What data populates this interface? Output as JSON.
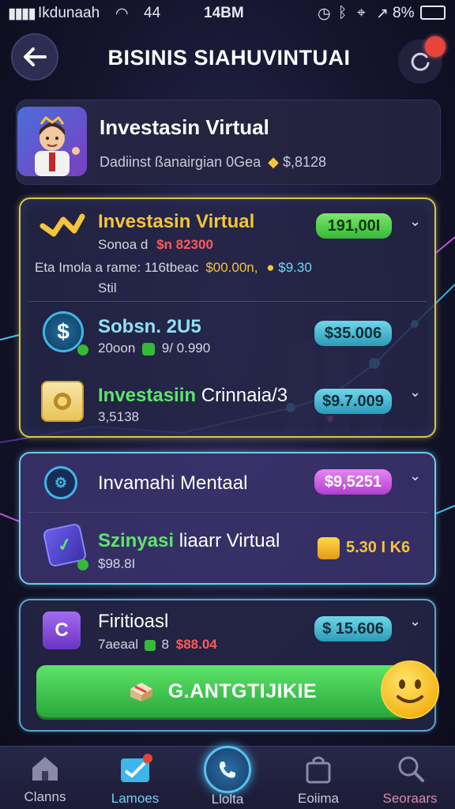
{
  "status_bar": {
    "carrier": "Ikdunaah",
    "signal_extra": "44",
    "time": "14BM",
    "battery": "8%"
  },
  "header": {
    "title": "BISINIS SIAHUVINTUAI"
  },
  "profile": {
    "title": "Investasin Virtual",
    "subtitle": "Dadiinst ßanairgian 0Gea",
    "value": "$,8128"
  },
  "sections": [
    {
      "rows": [
        {
          "title": "Investasin Virtual",
          "line1_prefix": "Sonoa d",
          "line1_amount": "$n 82300",
          "line2_prefix": "Eta Imola a rame: 116tbeac",
          "line2_amount": "$00.00n,",
          "line2_right": "$9.30",
          "line3": "Stil",
          "badge": "191,00I"
        },
        {
          "title": "Sobsn. 2U5",
          "line1_prefix": "20oon",
          "line1_amount": "9/ 0.990",
          "badge": "$35.006"
        },
        {
          "title_green": "Investasiin",
          "title_rest": "Crinnaia/3",
          "line1_prefix": "3,5138",
          "badge": "$9.7.009"
        }
      ]
    },
    {
      "rows": [
        {
          "title": "Invamahi Mentaal",
          "badge": "$9,5251"
        },
        {
          "title_green": "Szinyasi",
          "title_rest": "liaarr Virtual",
          "line1_prefix": "$98.8I",
          "badge": "5.30 I K6"
        }
      ]
    },
    {
      "rows": [
        {
          "title": "Firitioasl",
          "line1_prefix": "7aeaal",
          "line1_mid": "8",
          "line1_amount": "$88.04",
          "badge": "$ 15.606"
        }
      ]
    }
  ],
  "cta": {
    "label": "G.ANTGTIJIKIE"
  },
  "bottom_nav": [
    {
      "label": "Clanns",
      "icon": "home-icon"
    },
    {
      "label": "Lamoes",
      "icon": "chart-check-icon"
    },
    {
      "label": "Llolta",
      "icon": "phone-icon"
    },
    {
      "label": "Eoiima",
      "icon": "bag-icon"
    },
    {
      "label": "Seoraars",
      "icon": "search-icon"
    }
  ],
  "colors": {
    "accent_gold": "#d8c64a",
    "accent_teal": "#6fc9ea",
    "accent_green": "#35b936",
    "accent_purple": "#b23fd0",
    "danger_red": "#e8443a"
  }
}
